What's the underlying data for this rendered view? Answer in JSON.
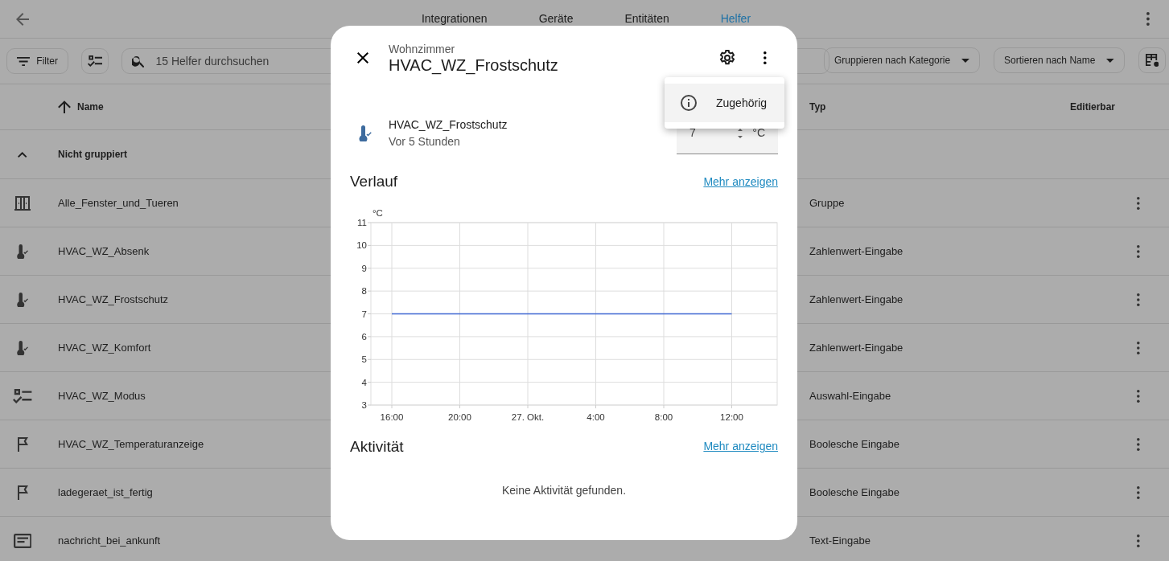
{
  "top_bar": {
    "tabs": [
      {
        "label": "Integrationen",
        "selected": false
      },
      {
        "label": "Geräte",
        "selected": false
      },
      {
        "label": "Entitäten",
        "selected": false
      },
      {
        "label": "Helfer",
        "selected": true
      }
    ]
  },
  "toolbar": {
    "filter": "Filter",
    "search": {
      "placeholder": "15 Helfer durchsuchen"
    },
    "group_by": "Gruppieren nach Kategorie",
    "sort_by": "Sortieren nach Name"
  },
  "table": {
    "columns": [
      {
        "label": "Name",
        "sorted": true
      },
      {
        "label": "Typ"
      },
      {
        "label": "Editierbar"
      }
    ],
    "group": {
      "label": "Nicht gruppiert",
      "expanded": true
    },
    "rows": [
      {
        "kind": "window",
        "name": "Alle_Fenster_und_Tueren",
        "type": "Gruppe"
      },
      {
        "kind": "thermometer",
        "name": "HVAC_WZ_Absenk",
        "type": "Zahlenwert-Eingabe"
      },
      {
        "kind": "thermometer",
        "name": "HVAC_WZ_Frostschutz",
        "type": "Zahlenwert-Eingabe"
      },
      {
        "kind": "thermometer",
        "name": "HVAC_WZ_Komfort",
        "type": "Zahlenwert-Eingabe"
      },
      {
        "kind": "checklist",
        "name": "HVAC_WZ_Modus",
        "type": "Auswahl-Eingabe"
      },
      {
        "kind": "flag",
        "name": "HVAC_WZ_Temperaturanzeige",
        "type": "Boolesche Eingabe"
      },
      {
        "kind": "flag",
        "name": "ladegeraet_ist_fertig",
        "type": "Boolesche Eingabe"
      },
      {
        "kind": "text",
        "name": "nachricht_bei_ankunft",
        "type": "Text-Eingabe"
      }
    ]
  },
  "dialog": {
    "subtitle": "Wohnzimmer",
    "title": "HVAC_WZ_Frostschutz",
    "menu": {
      "items": [
        {
          "label": "Zugehörig"
        }
      ]
    },
    "entity": {
      "name": "HVAC_WZ_Frostschutz",
      "last_changed": "Vor 5 Stunden",
      "value": "7",
      "unit": "°C"
    },
    "history": {
      "heading": "Verlauf",
      "more": "Mehr anzeigen",
      "chart_data": {
        "type": "line",
        "ylabel": "°C",
        "ylim": [
          3,
          11
        ],
        "yticks": [
          3,
          4,
          5,
          6,
          7,
          8,
          9,
          10,
          11
        ],
        "grid": true,
        "categories": [
          "16:00",
          "20:00",
          "27. Okt.",
          "4:00",
          "8:00",
          "12:00"
        ],
        "series": [
          {
            "color": "#3f66d1",
            "values": [
              7,
              7,
              7,
              7,
              7,
              7
            ]
          }
        ]
      }
    },
    "activity": {
      "heading": "Aktivität",
      "more": "Mehr anzeigen",
      "empty": "Keine Aktivität gefunden."
    }
  }
}
